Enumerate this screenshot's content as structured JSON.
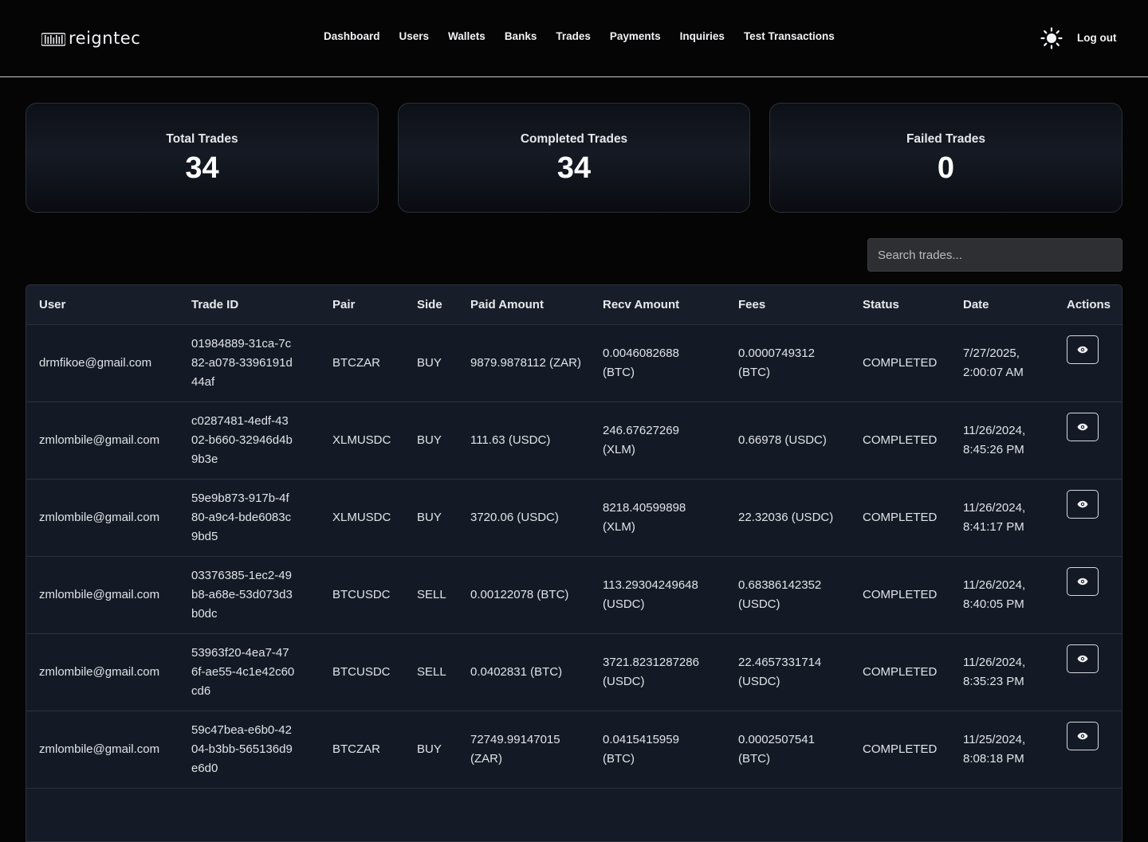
{
  "header": {
    "logo_text": "reigntec",
    "nav": [
      "Dashboard",
      "Users",
      "Wallets",
      "Banks",
      "Trades",
      "Payments",
      "Inquiries",
      "Test Transactions"
    ],
    "theme_icon": "sun-icon",
    "logout_label": "Log out"
  },
  "stats": [
    {
      "label": "Total Trades",
      "value": "34"
    },
    {
      "label": "Completed Trades",
      "value": "34"
    },
    {
      "label": "Failed Trades",
      "value": "0"
    }
  ],
  "search": {
    "placeholder": "Search trades..."
  },
  "table": {
    "columns": [
      "User",
      "Trade ID",
      "Pair",
      "Side",
      "Paid Amount",
      "Recv Amount",
      "Fees",
      "Status",
      "Date",
      "Actions"
    ],
    "rows": [
      {
        "user": "drmfikoe@gmail.com",
        "trade_id": "01984889-31ca-7c82-a078-3396191d44af",
        "pair": "BTCZAR",
        "side": "BUY",
        "paid": "9879.9878112 (ZAR)",
        "recv": "0.0046082688 (BTC)",
        "fees": "0.0000749312 (BTC)",
        "status": "COMPLETED",
        "date": "7/27/2025, 2:00:07 AM"
      },
      {
        "user": "zmlombile@gmail.com",
        "trade_id": "c0287481-4edf-4302-b660-32946d4b9b3e",
        "pair": "XLMUSDC",
        "side": "BUY",
        "paid": "111.63 (USDC)",
        "recv": "246.67627269 (XLM)",
        "fees": "0.66978 (USDC)",
        "status": "COMPLETED",
        "date": "11/26/2024, 8:45:26 PM"
      },
      {
        "user": "zmlombile@gmail.com",
        "trade_id": "59e9b873-917b-4f80-a9c4-bde6083c9bd5",
        "pair": "XLMUSDC",
        "side": "BUY",
        "paid": "3720.06 (USDC)",
        "recv": "8218.40599898 (XLM)",
        "fees": "22.32036 (USDC)",
        "status": "COMPLETED",
        "date": "11/26/2024, 8:41:17 PM"
      },
      {
        "user": "zmlombile@gmail.com",
        "trade_id": "03376385-1ec2-49b8-a68e-53d073d3b0dc",
        "pair": "BTCUSDC",
        "side": "SELL",
        "paid": "0.00122078 (BTC)",
        "recv": "113.29304249648 (USDC)",
        "fees": "0.68386142352 (USDC)",
        "status": "COMPLETED",
        "date": "11/26/2024, 8:40:05 PM"
      },
      {
        "user": "zmlombile@gmail.com",
        "trade_id": "53963f20-4ea7-476f-ae55-4c1e42c60cd6",
        "pair": "BTCUSDC",
        "side": "SELL",
        "paid": "0.0402831 (BTC)",
        "recv": "3721.8231287286 (USDC)",
        "fees": "22.4657331714 (USDC)",
        "status": "COMPLETED",
        "date": "11/26/2024, 8:35:23 PM"
      },
      {
        "user": "zmlombile@gmail.com",
        "trade_id": "59c47bea-e6b0-4204-b3bb-565136d9e6d0",
        "pair": "BTCZAR",
        "side": "BUY",
        "paid": "72749.99147015 (ZAR)",
        "recv": "0.0415415959 (BTC)",
        "fees": "0.0002507541 (BTC)",
        "status": "COMPLETED",
        "date": "11/25/2024, 8:08:18 PM"
      }
    ],
    "action_icon": "eye-icon"
  }
}
